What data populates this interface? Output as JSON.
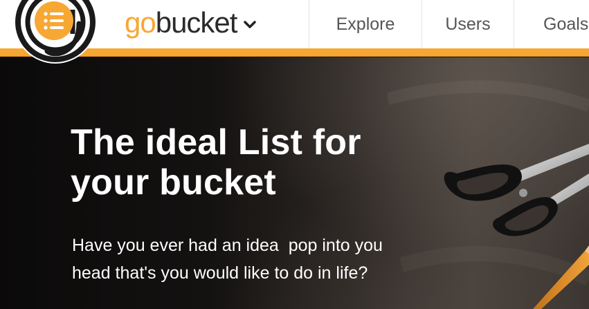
{
  "header": {
    "brand": {
      "prefix": "go",
      "suffix": "bucket"
    },
    "nav": [
      {
        "label": "Explore"
      },
      {
        "label": "Users"
      },
      {
        "label": "Goals"
      }
    ]
  },
  "hero": {
    "title_line1": "The ideal List for",
    "title_line2": "your bucket",
    "subtitle_line1": "Have you ever had an idea  pop into you",
    "subtitle_line2": "head that's you would like to do in life?"
  },
  "colors": {
    "accent": "#f7a733",
    "text_dark": "#2b2b2b",
    "nav_text": "#555555"
  },
  "icons": [
    "logo-badge-icon",
    "list-icon",
    "chevron-down-icon"
  ]
}
